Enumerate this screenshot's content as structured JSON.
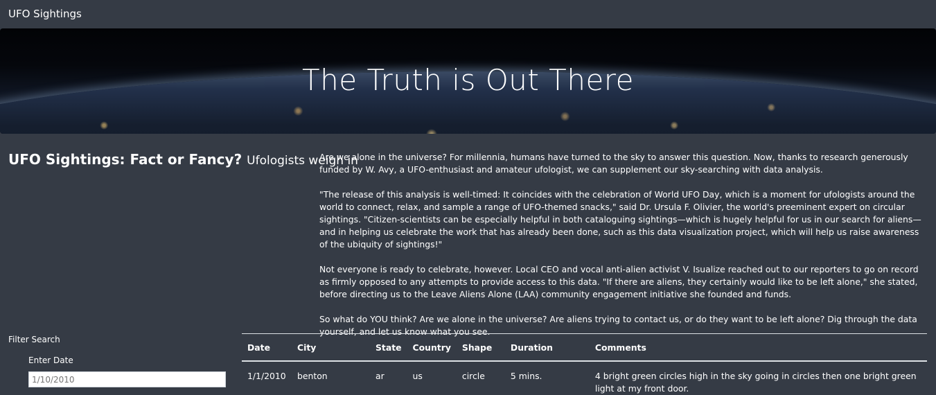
{
  "navbar": {
    "brand": "UFO Sightings"
  },
  "hero": {
    "title": "The Truth is Out There"
  },
  "section": {
    "title": "UFO Sightings: Fact or Fancy?",
    "subtitle": "Ufologists weigh in"
  },
  "article": {
    "paragraphs": [
      "Are we alone in the universe? For millennia, humans have turned to the sky to answer this question. Now, thanks to research generously funded by W. Avy, a UFO-enthusiast and amateur ufologist, we can supplement our sky-searching with data analysis.",
      "\"The release of this analysis is well-timed: It coincides with the celebration of World UFO Day, which is a moment for ufologists around the world to connect, relax, and sample a range of UFO-themed snacks,\" said Dr. Ursula F. Olivier, the world's preeminent expert on circular sightings. \"Citizen-scientists can be especially helpful in both cataloguing sightings—which is hugely helpful for us in our search for aliens—and in helping us celebrate the work that has already been done, such as this data visualization project, which will help us raise awareness of the ubiquity of sightings!\"",
      "Not everyone is ready to celebrate, however. Local CEO and vocal anti-alien activist V. Isualize reached out to our reporters to go on record as firmly opposed to any attempts to provide access to this data. \"If there are aliens, they certainly would like to be left alone,\" she stated, before directing us to the Leave Aliens Alone (LAA) community engagement initiative she founded and funds.",
      "So what do YOU think? Are we alone in the universe? Are aliens trying to contact us, or do they want to be left alone? Dig through the data yourself, and let us know what you see."
    ]
  },
  "filters": {
    "title": "Filter Search",
    "date_label": "Enter Date",
    "date_placeholder": "1/10/2010"
  },
  "table": {
    "headers": [
      "Date",
      "City",
      "State",
      "Country",
      "Shape",
      "Duration",
      "Comments"
    ],
    "rows": [
      [
        "1/1/2010",
        "benton",
        "ar",
        "us",
        "circle",
        "5 mins.",
        "4 bright green circles high in the sky going in circles then one bright green light at my front door."
      ]
    ]
  }
}
